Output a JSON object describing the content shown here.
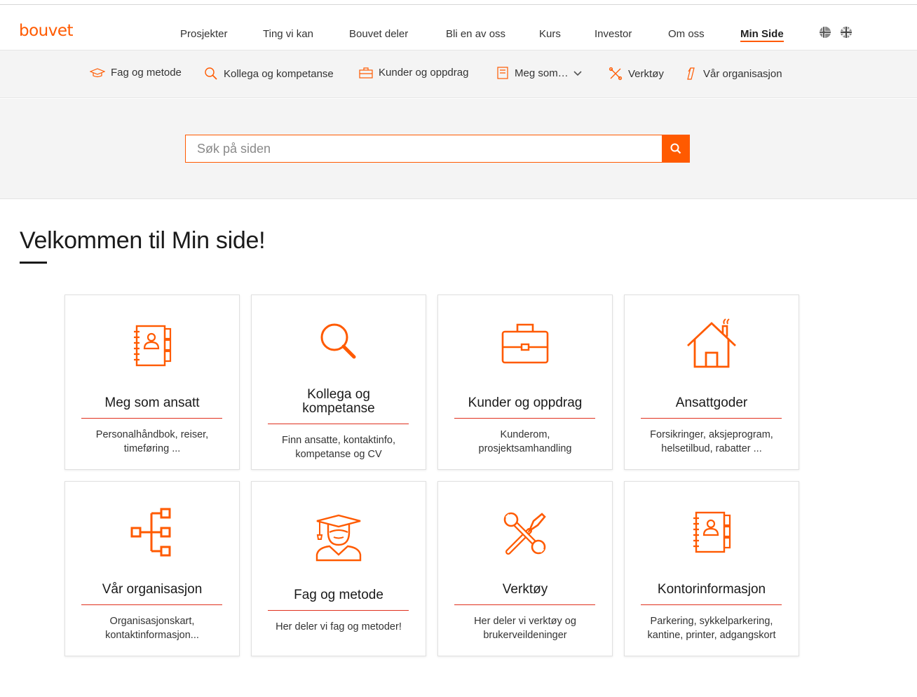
{
  "brand": {
    "logo_text": "bouvet",
    "accent": "#ff5a00",
    "rule_color": "#e0301e"
  },
  "topnav": {
    "items": [
      {
        "label": "Prosjekter"
      },
      {
        "label": "Ting vi kan"
      },
      {
        "label": "Bouvet deler"
      },
      {
        "label": "Bli en av oss"
      },
      {
        "label": "Kurs"
      },
      {
        "label": "Investor"
      },
      {
        "label": "Om oss"
      },
      {
        "label": "Min Side",
        "active": true
      }
    ],
    "languages": [
      "norwegian-flag-icon",
      "uk-flag-icon"
    ]
  },
  "subnav": {
    "items": [
      {
        "label": "Fag og metode",
        "icon": "graduation-cap-icon"
      },
      {
        "label": "Kollega og kompetanse",
        "icon": "search-icon"
      },
      {
        "label": "Kunder og oppdrag",
        "icon": "briefcase-icon"
      },
      {
        "label": "Meg som…",
        "icon": "address-book-icon",
        "has_dropdown": true
      },
      {
        "label": "Verktøy",
        "icon": "tools-icon"
      },
      {
        "label": "Vår organisasjon",
        "icon": "organization-icon"
      }
    ]
  },
  "search": {
    "placeholder": "Søk på siden"
  },
  "page": {
    "title": "Velkommen til Min side!"
  },
  "cards": [
    {
      "title": "Meg som ansatt",
      "desc_line1": "Personalhåndbok, reiser,",
      "desc_line2": "timeføring ...",
      "icon": "address-book-icon"
    },
    {
      "title_line1": "Kollega og",
      "title_line2": "kompetanse",
      "desc_line1": "Finn ansatte, kontaktinfo,",
      "desc_line2": "kompetanse og CV",
      "icon": "search-icon"
    },
    {
      "title": "Kunder og oppdrag",
      "desc_line1": "Kunderom,",
      "desc_line2": "prosjektsamhandling",
      "icon": "briefcase-icon"
    },
    {
      "title": "Ansattgoder",
      "desc_line1": "Forsikringer, aksjeprogram,",
      "desc_line2": "helsetilbud, rabatter ...",
      "icon": "house-icon"
    },
    {
      "title": "Vår organisasjon",
      "desc_line1": "Organisasjonskart,",
      "desc_line2": "kontaktinformasjon...",
      "icon": "organization-icon"
    },
    {
      "title": "Fag og metode",
      "desc_line1": "Her deler vi fag og metoder!",
      "icon": "graduation-icon"
    },
    {
      "title": "Verktøy",
      "desc_line1": "Her deler vi verktøy og",
      "desc_line2": "brukerveildeninger",
      "icon": "tools-icon"
    },
    {
      "title": "Kontorinformasjon",
      "desc_line1": "Parkering, sykkelparkering,",
      "desc_line2": "kantine, printer, adgangskort",
      "icon": "address-book-icon"
    }
  ]
}
